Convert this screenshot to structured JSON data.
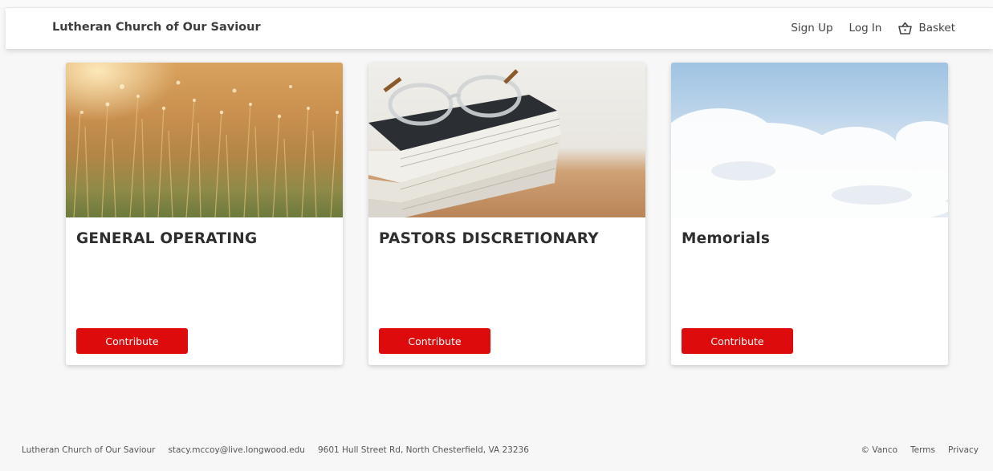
{
  "header": {
    "brand": "Lutheran Church of Our Saviour",
    "nav": {
      "sign_up": "Sign Up",
      "log_in": "Log In",
      "basket": "Basket"
    }
  },
  "cards": [
    {
      "title": "GENERAL OPERATING",
      "button": "Contribute"
    },
    {
      "title": "PASTORS DISCRETIONARY",
      "button": "Contribute"
    },
    {
      "title": "Memorials",
      "button": "Contribute"
    }
  ],
  "footer": {
    "org": "Lutheran Church of Our Saviour",
    "email": "stacy.mccoy@live.longwood.edu",
    "address": "9601 Hull Street Rd, North Chesterfield, VA 23236",
    "copyright": "© Vanco",
    "terms": "Terms",
    "privacy": "Privacy"
  },
  "colors": {
    "accent": "#dd0b0b",
    "background": "#f7f7f7"
  }
}
